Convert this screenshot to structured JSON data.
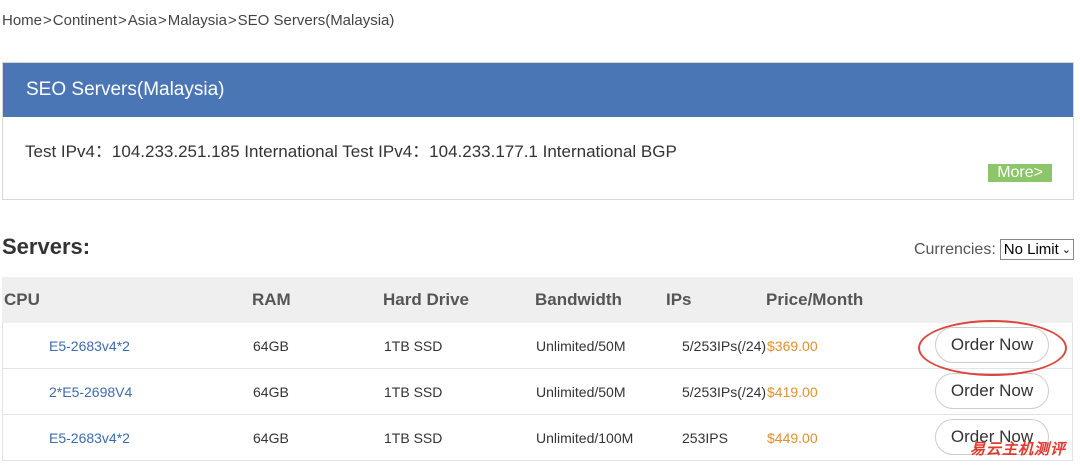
{
  "breadcrumb": {
    "items": [
      "Home",
      "Continent",
      "Asia",
      "Malaysia",
      "SEO Servers(Malaysia)"
    ],
    "separator": ">"
  },
  "panel": {
    "title": "SEO Servers(Malaysia)",
    "text": "Test IPv4：104.233.251.185 International Test IPv4：104.233.177.1 International BGP",
    "more_label": "More>"
  },
  "servers": {
    "title": "Servers:",
    "currencies_label": "Currencies:",
    "currency_selected": "No Limit"
  },
  "table": {
    "headers": {
      "cpu": "CPU",
      "ram": "RAM",
      "hard_drive": "Hard Drive",
      "bandwidth": "Bandwidth",
      "ips": "IPs",
      "price": "Price/Month"
    },
    "rows": [
      {
        "cpu": "E5-2683v4*2",
        "ram": "64GB",
        "hard_drive": "1TB SSD",
        "bandwidth": "Unlimited/50M",
        "ips": "5/253IPs(/24)",
        "price": "$369.00",
        "order_label": "Order Now"
      },
      {
        "cpu": "2*E5-2698V4",
        "ram": "64GB",
        "hard_drive": "1TB SSD",
        "bandwidth": "Unlimited/50M",
        "ips": "5/253IPs(/24)",
        "price": "$419.00",
        "order_label": "Order Now"
      },
      {
        "cpu": "E5-2683v4*2",
        "ram": "64GB",
        "hard_drive": "1TB SSD",
        "bandwidth": "Unlimited/100M",
        "ips": "253IPS",
        "price": "$449.00",
        "order_label": "Order Now"
      }
    ]
  },
  "watermark": "易云主机测评",
  "colors": {
    "header_blue": "#4a76b6",
    "more_green": "#8dc66a",
    "cpu_link": "#3c6bb0",
    "price_orange": "#e0902e",
    "annotation_red": "#d9473f"
  }
}
